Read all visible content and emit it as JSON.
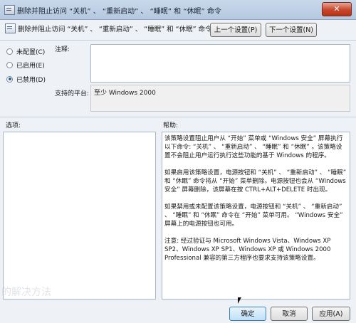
{
  "window": {
    "title": "删除并阻止访问 “关机” 、 “重新启动” 、 “睡眠” 和 “休眠” 命令"
  },
  "header": {
    "title": "删除并阻止访问 “关机” 、 “重新启动” 、 “睡眠” 和 “休眠” 命令",
    "prev_setting": "上一个设置(P)",
    "next_setting": "下一个设置(N)"
  },
  "options": [
    {
      "label": "未配置(C)",
      "selected": false
    },
    {
      "label": "已启用(E)",
      "selected": false
    },
    {
      "label": "已禁用(D)",
      "selected": true
    }
  ],
  "comment_label": "注释:",
  "comment_value": "",
  "platform_label": "支持的平台:",
  "platform_value": "至少 Windows 2000",
  "options_label": "选项:",
  "help_label": "帮助:",
  "help_paragraphs": [
    "该策略设置阻止用户从 “开始” 菜单或 “Windows 安全” 屏幕执行以下命令: “关机” 、 “重新启动” 、 “睡眠” 和 “休眠” 。该策略设置不会阻止用户运行执行这些功能的基于 Windows 的程序。",
    "如果启用该策略设置，电源按钮和 “关机” 、 “重新启动” 、 “睡眠” 和 “休眠” 命令将从 “开始” 菜单删除。电源按钮也会从 “Windows 安全” 屏幕删除，该屏幕在按 CTRL+ALT+DELETE 时出现。",
    "如果禁用或未配置该策略设置，电源按钮和 “关机” 、 “重新启动” 、 “睡眠” 和 “休眠” 命令在 “开始” 菜单可用。 “Windows 安全” 屏幕上的电源按钮也可用。",
    "注意: 经过验证与 Microsoft Windows Vista、Windows XP SP2、Windows XP SP1、Windows XP 或 Windows 2000 Professional 兼容的第三方程序也要求支持该策略设置。"
  ],
  "footer": {
    "ok": "确定",
    "cancel": "取消",
    "apply": "应用(A)"
  },
  "watermark": "的解决方法",
  "close_glyph": "✕"
}
